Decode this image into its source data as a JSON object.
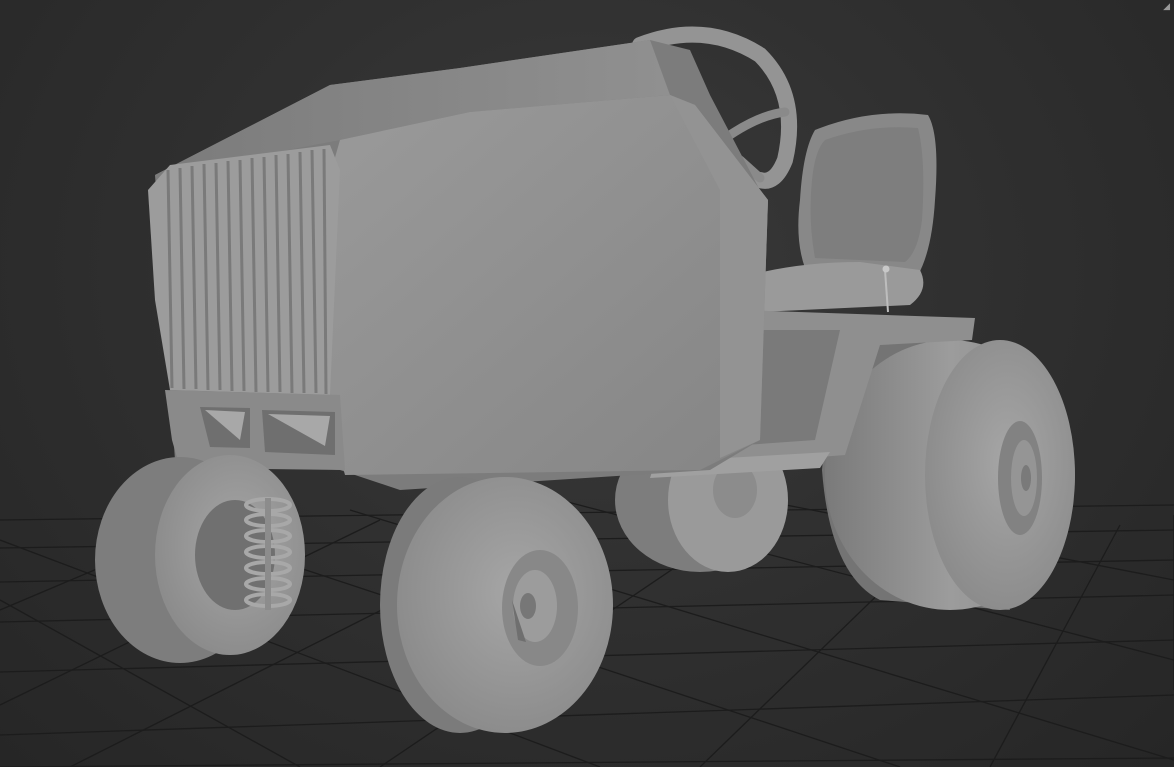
{
  "viewport": {
    "render_mode": "shaded",
    "background_color": "#2b2b2b",
    "grid_color": "#1e1e1e",
    "model_color": "#8e8e8e",
    "grid_visible": true
  },
  "scene": {
    "model": "lawn-tractor-icon",
    "objects": [
      "hood-grille",
      "steering-wheel",
      "seat",
      "front-wheel-left",
      "front-wheel-right",
      "rear-wheel-left",
      "rear-wheel-right",
      "suspension-spring",
      "footboard"
    ]
  },
  "gizmo": {
    "icon": "viewcube-corner-icon"
  }
}
